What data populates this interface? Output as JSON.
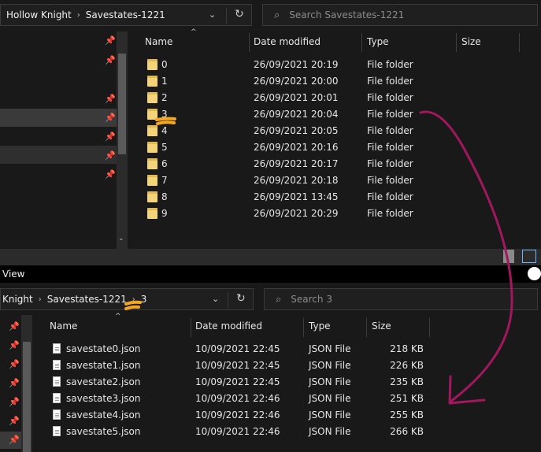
{
  "top": {
    "breadcrumb": [
      "Hollow Knight",
      "Savestates-1221"
    ],
    "search_placeholder": "Search Savestates-1221",
    "columns": [
      "Name",
      "Date modified",
      "Type",
      "Size"
    ],
    "rows": [
      {
        "name": "0",
        "date": "26/09/2021 20:19",
        "type": "File folder",
        "size": ""
      },
      {
        "name": "1",
        "date": "26/09/2021 20:00",
        "type": "File folder",
        "size": ""
      },
      {
        "name": "2",
        "date": "26/09/2021 20:01",
        "type": "File folder",
        "size": ""
      },
      {
        "name": "3",
        "date": "26/09/2021 20:04",
        "type": "File folder",
        "size": ""
      },
      {
        "name": "4",
        "date": "26/09/2021 20:05",
        "type": "File folder",
        "size": ""
      },
      {
        "name": "5",
        "date": "26/09/2021 20:16",
        "type": "File folder",
        "size": ""
      },
      {
        "name": "6",
        "date": "26/09/2021 20:17",
        "type": "File folder",
        "size": ""
      },
      {
        "name": "7",
        "date": "26/09/2021 20:18",
        "type": "File folder",
        "size": ""
      },
      {
        "name": "8",
        "date": "26/09/2021 13:45",
        "type": "File folder",
        "size": ""
      },
      {
        "name": "9",
        "date": "26/09/2021 20:29",
        "type": "File folder",
        "size": ""
      }
    ]
  },
  "menu": {
    "view": "View"
  },
  "bottom": {
    "breadcrumb": [
      "Knight",
      "Savestates-1221",
      "3"
    ],
    "search_placeholder": "Search 3",
    "columns": [
      "Name",
      "Date modified",
      "Type",
      "Size"
    ],
    "rows": [
      {
        "name": "savestate0.json",
        "date": "10/09/2021 22:45",
        "type": "JSON File",
        "size": "218 KB"
      },
      {
        "name": "savestate1.json",
        "date": "10/09/2021 22:45",
        "type": "JSON File",
        "size": "226 KB"
      },
      {
        "name": "savestate2.json",
        "date": "10/09/2021 22:45",
        "type": "JSON File",
        "size": "235 KB"
      },
      {
        "name": "savestate3.json",
        "date": "10/09/2021 22:46",
        "type": "JSON File",
        "size": "251 KB"
      },
      {
        "name": "savestate4.json",
        "date": "10/09/2021 22:46",
        "type": "JSON File",
        "size": "255 KB"
      },
      {
        "name": "savestate5.json",
        "date": "10/09/2021 22:46",
        "type": "JSON File",
        "size": "266 KB"
      }
    ]
  },
  "colors": {
    "annotation_orange": "#f5a623",
    "annotation_magenta": "#a3175f"
  },
  "icons": [
    "folder-icon",
    "json-file-icon",
    "pin-icon",
    "refresh-icon",
    "search-icon",
    "chevron-down-icon",
    "sort-up-icon"
  ]
}
